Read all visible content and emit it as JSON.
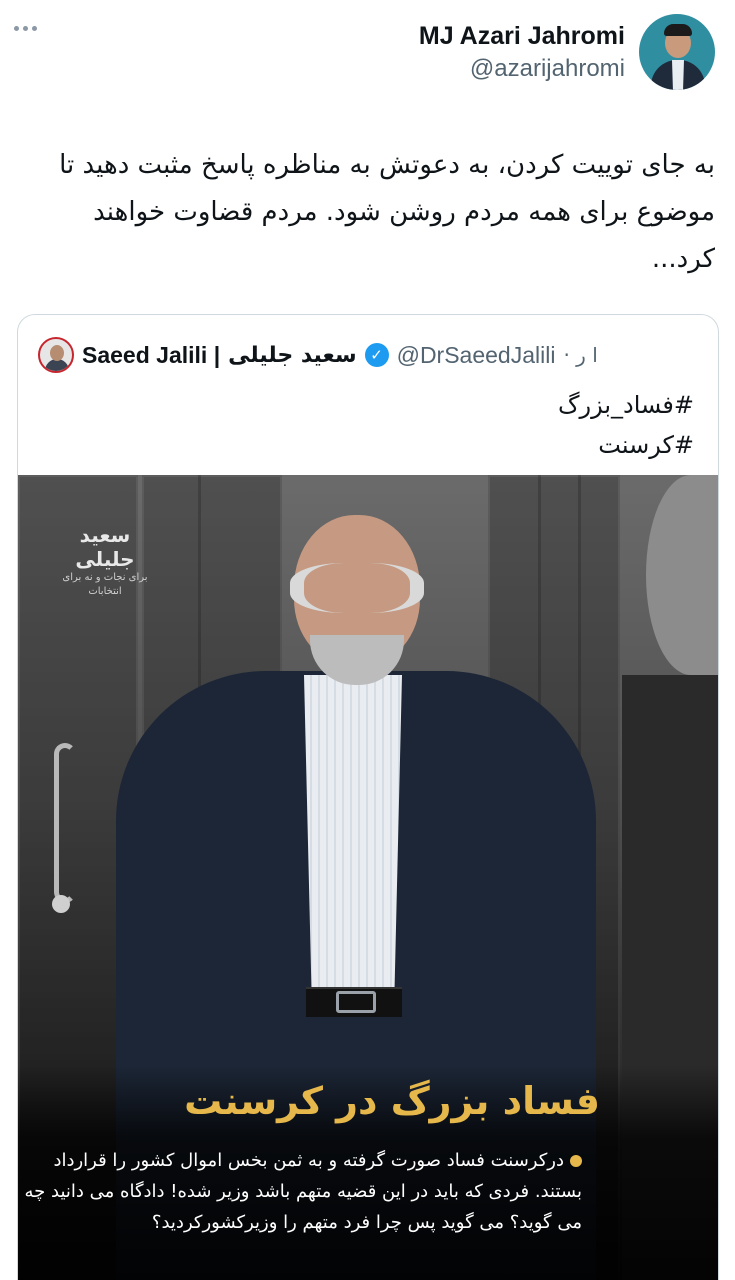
{
  "tweet": {
    "author": {
      "display_name": "MJ Azari Jahromi",
      "handle": "@azarijahromi"
    },
    "text": "به جای توییت کردن، به دعوتش به مناظره پاسخ مثبت دهید تا موضوع برای همه مردم روشن شود. مردم قضاوت خواهند کرد...",
    "more_icon": "more-horizontal-icon"
  },
  "quoted_tweet": {
    "name_en": "Saeed Jalili |",
    "name_fa": "سعید جلیلی",
    "verified_icon": "verified-badge-icon",
    "handle": "@DrSaeedJalili",
    "time": "· ا ر",
    "hashtags": [
      "#فساد_بزرگ",
      "#کرسنت"
    ],
    "media": {
      "signature": "سعید جلیلی",
      "signature_sub": "برای نجات و نه برای انتخابات",
      "headline": "فساد بزرگ در کرسنت",
      "body": "درکرسنت فساد صورت گرفته و به ثمن بخس اموال کشور را قرارداد بستند. فردی که باید در این قضیه متهم باشد وزیر شده! دادگاه می دانید چه می گوید؟ می گوید پس چرا فرد متهم را وزیرکشورکردید؟"
    }
  },
  "colors": {
    "verified": "#1d9bf0",
    "headline": "#e6b84c",
    "secondary_text": "#536471"
  }
}
